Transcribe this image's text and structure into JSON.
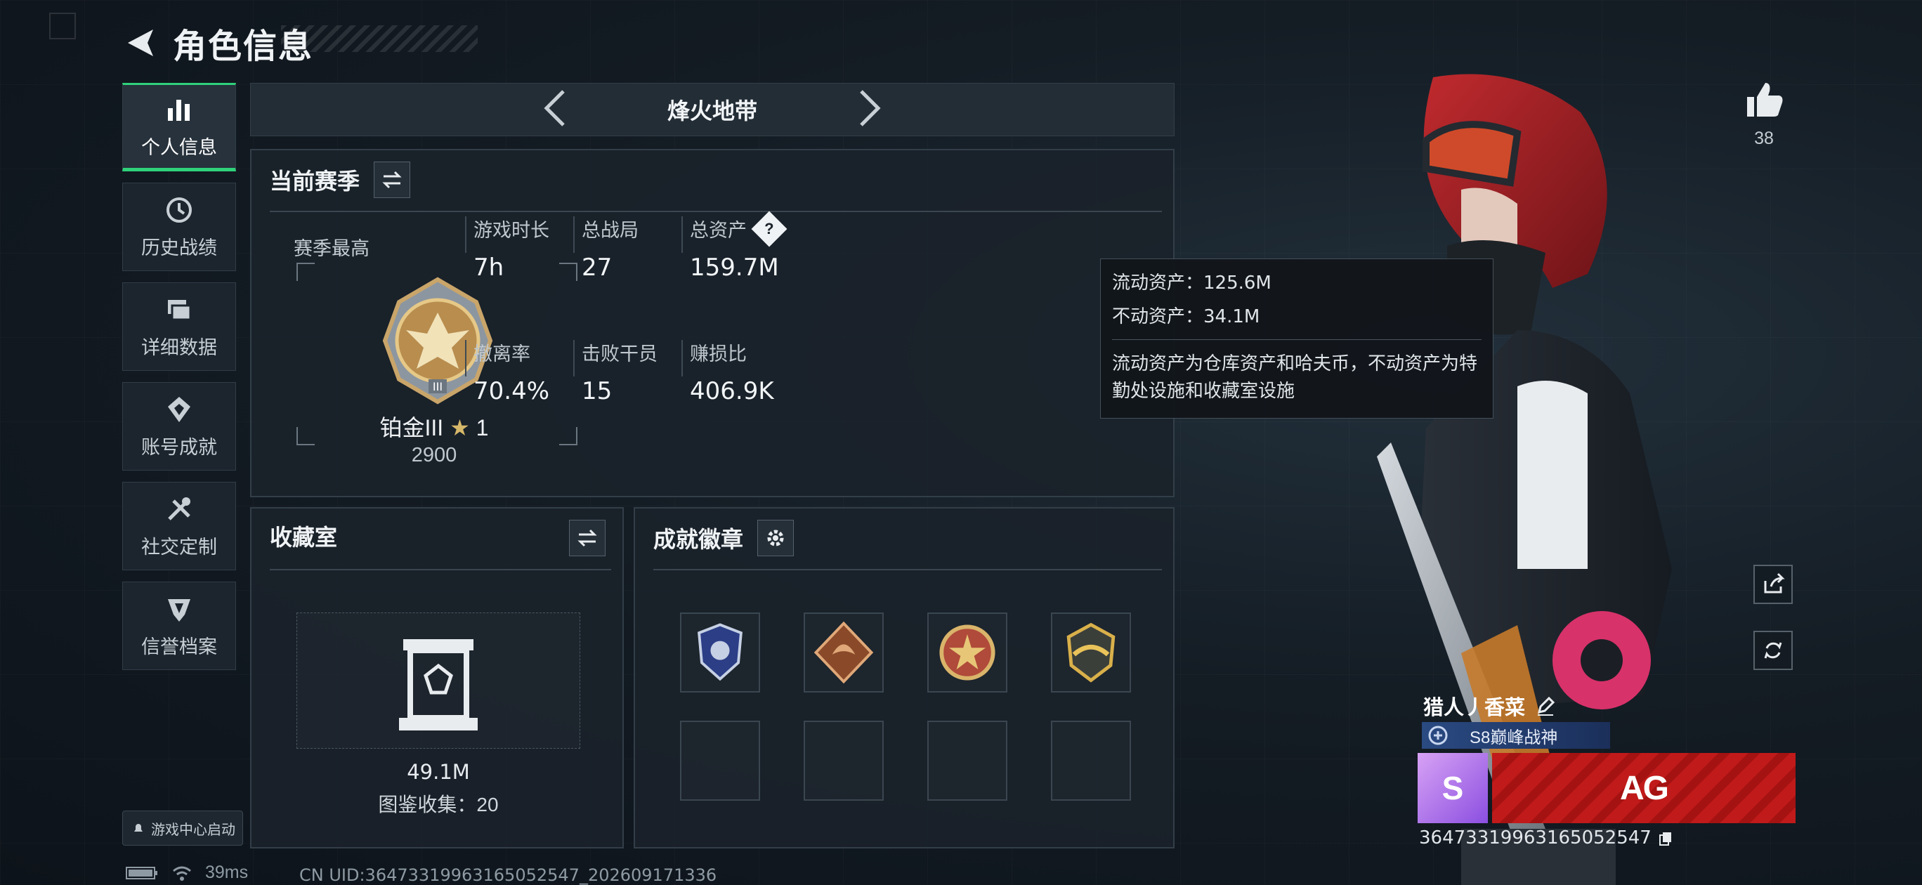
{
  "header": {
    "title": "角色信息"
  },
  "sidebar": {
    "items": [
      {
        "label": "个人信息",
        "icon": "bar-chart-icon",
        "active": true
      },
      {
        "label": "历史战绩",
        "icon": "history-icon"
      },
      {
        "label": "详细数据",
        "icon": "folder-stack-icon"
      },
      {
        "label": "账号成就",
        "icon": "medal-icon"
      },
      {
        "label": "社交定制",
        "icon": "tools-icon"
      },
      {
        "label": "信誉档案",
        "icon": "shield-emblem-icon"
      }
    ],
    "game_center": "游戏中心启动"
  },
  "season_nav": {
    "title": "烽火地带"
  },
  "current_season": {
    "title": "当前赛季",
    "best_label": "赛季最高",
    "rank": {
      "name": "铂金III",
      "stars": "1",
      "score": "2900"
    },
    "stats": [
      {
        "label": "游戏时长",
        "value": "7h"
      },
      {
        "label": "总战局",
        "value": "27"
      },
      {
        "label": "总资产",
        "value": "159.7M"
      },
      {
        "label": "撤离率",
        "value": "70.4%"
      },
      {
        "label": "击败干员",
        "value": "15"
      },
      {
        "label": "赚损比",
        "value": "406.9K"
      }
    ]
  },
  "tooltip": {
    "liquid": "流动资产：125.6M",
    "fixed": "不动资产：34.1M",
    "desc": "流动资产为仓库资产和哈夫币，不动资产为特勤处设施和收藏室设施"
  },
  "collection": {
    "title": "收藏室",
    "value": "49.1M",
    "count": "图鉴收集：20"
  },
  "achievements": {
    "title": "成就徽章",
    "badges": [
      "blue-shield-badge",
      "dragon-diamond-badge",
      "star-cross-badge",
      "gold-wing-badge"
    ]
  },
  "profile": {
    "likes": "38",
    "name": "猎人丿香菜",
    "title": "S8巅峰战神",
    "avatar_letter": "S",
    "banner_logo": "AG",
    "uid": "36473319963165052547"
  },
  "status": {
    "ping": "39ms",
    "cn_uid": "CN UID:36473319963165052547_202609171336"
  },
  "colors": {
    "accent": "#2fd17a",
    "banner": "#c11a1a",
    "title_bg": "#2a4a82"
  }
}
